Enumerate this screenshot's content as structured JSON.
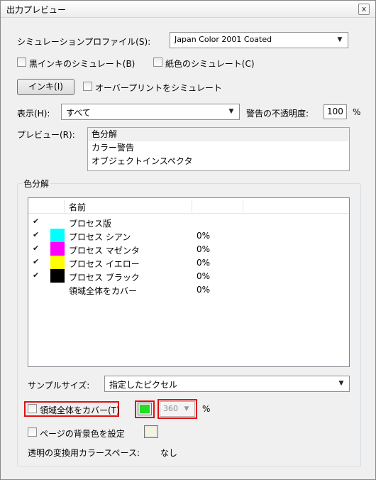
{
  "window": {
    "title": "出力プレビュー",
    "close_label": "x"
  },
  "simulation": {
    "profile_label": "シミュレーションプロファイル(S):",
    "profile_value": "Japan Color 2001 Coated",
    "black_ink_label": "黒インキのシミュレート(B)",
    "black_ink_checked": false,
    "paper_color_label": "紙色のシミュレート(C)",
    "paper_color_checked": false
  },
  "ink": {
    "button_label": "インキ(I)",
    "overprint_label": "オーバープリントをシミュレート",
    "overprint_checked": false
  },
  "display": {
    "label": "表示(H):",
    "value": "すべて",
    "warning_label": "警告の不透明度:",
    "warning_value": "100",
    "percent": "%"
  },
  "preview": {
    "label": "プレビュー(R):",
    "items": [
      "色分解",
      "カラー警告",
      "オブジェクトインスペクタ"
    ],
    "selected_index": 0
  },
  "separations": {
    "group_title": "色分解",
    "header_name": "名前",
    "rows": [
      {
        "checked": true,
        "color": "",
        "name": "プロセス版",
        "value": ""
      },
      {
        "checked": true,
        "color": "#00ffff",
        "name": "プロセス シアン",
        "value": "0%"
      },
      {
        "checked": true,
        "color": "#ff00ff",
        "name": "プロセス マゼンタ",
        "value": "0%"
      },
      {
        "checked": true,
        "color": "#ffff00",
        "name": "プロセス イエロー",
        "value": "0%"
      },
      {
        "checked": true,
        "color": "#000000",
        "name": "プロセス ブラック",
        "value": "0%"
      },
      {
        "checked": null,
        "color": "",
        "name": "領域全体をカバー",
        "value": "0%"
      }
    ],
    "sample_size_label": "サンプルサイズ:",
    "sample_size_value": "指定したピクセル",
    "cover_label": "領域全体をカバー(T)",
    "cover_checked": false,
    "cover_color": "#22dd22",
    "cover_value": "360",
    "cover_percent": "%",
    "page_bg_label": "ページの背景色を設定",
    "page_bg_checked": false,
    "page_bg_color": "#f4f4dc",
    "transparency_label": "透明の変換用カラースペース:",
    "transparency_value": "なし"
  },
  "colors": {
    "highlight_red": "#e01010",
    "checkmark": "✔"
  }
}
